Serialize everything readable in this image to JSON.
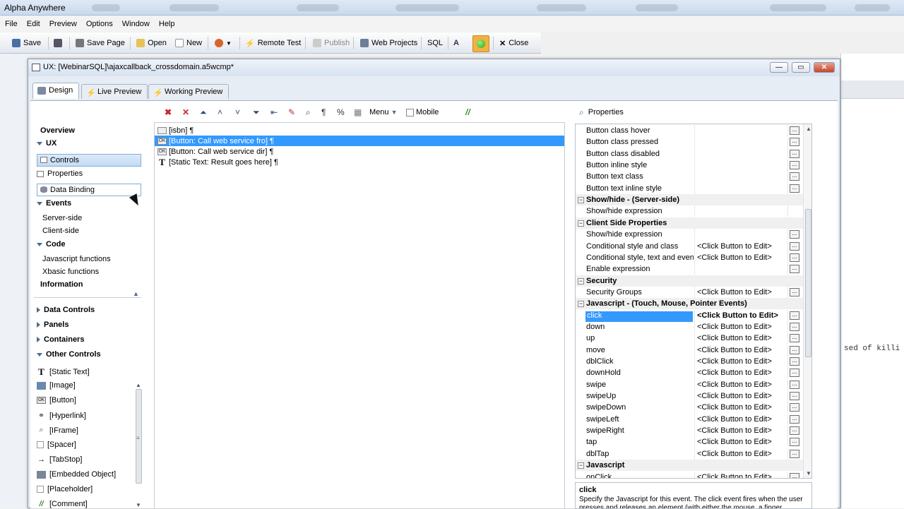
{
  "app": {
    "title": "Alpha Anywhere"
  },
  "menu": [
    "File",
    "Edit",
    "Preview",
    "Options",
    "Window",
    "Help"
  ],
  "toolbar": {
    "save": "Save",
    "save_page": "Save Page",
    "open": "Open",
    "new": "New",
    "remote_test": "Remote Test",
    "publish": "Publish",
    "web_projects": "Web Projects",
    "sql": "SQL",
    "close": "Close"
  },
  "dialog": {
    "title": "UX: [WebinarSQL]\\ajaxcallback_crossdomain.a5wcmp*"
  },
  "tabs": [
    "Design",
    "Live Preview",
    "Working Preview"
  ],
  "leftnav": {
    "overview": "Overview",
    "ux": "UX",
    "controls": "Controls",
    "properties": "Properties",
    "data_binding": "Data Binding",
    "events": "Events",
    "server_side": "Server-side",
    "client_side": "Client-side",
    "code": "Code",
    "js_functions": "Javascript functions",
    "xbasic_functions": "Xbasic functions",
    "information": "Information",
    "data_controls": "Data Controls",
    "panels": "Panels",
    "containers": "Containers",
    "other_controls": "Other Controls",
    "controls_list": [
      "[Static Text]",
      "[Image]",
      "[Button]",
      "[Hyperlink]",
      "[IFrame]",
      "[Spacer]",
      "[TabStop]",
      "[Embedded Object]",
      "[Placeholder]",
      "[Comment]"
    ]
  },
  "editor": {
    "menu_label": "Menu",
    "mobile_label": "Mobile"
  },
  "tree": [
    "[isbn] ¶",
    "[Button: Call web service fro] ¶",
    "[Button: Call web service dir] ¶",
    "[Static Text: Result goes here] ¶"
  ],
  "props": {
    "header": "Properties",
    "rows": [
      {
        "t": "p",
        "n": "Button class hover",
        "v": "",
        "e": true
      },
      {
        "t": "p",
        "n": "Button class pressed",
        "v": "",
        "e": true
      },
      {
        "t": "p",
        "n": "Button class disabled",
        "v": "",
        "e": true
      },
      {
        "t": "p",
        "n": "Button inline style",
        "v": "",
        "e": true
      },
      {
        "t": "p",
        "n": "Button text class",
        "v": "",
        "e": true
      },
      {
        "t": "p",
        "n": "Button text inline style",
        "v": "",
        "e": true
      },
      {
        "t": "s",
        "n": "Show/hide - (Server-side)"
      },
      {
        "t": "p",
        "n": "Show/hide expression",
        "v": "",
        "e": false
      },
      {
        "t": "s",
        "n": "Client Side Properties"
      },
      {
        "t": "p",
        "n": "Show/hide expression",
        "v": "",
        "e": true
      },
      {
        "t": "p",
        "n": "Conditional style and class",
        "v": "<Click Button to Edit>",
        "e": true
      },
      {
        "t": "p",
        "n": "Conditional style, text and events",
        "v": "<Click Button to Edit>",
        "e": true
      },
      {
        "t": "p",
        "n": "Enable expression",
        "v": "",
        "e": true
      },
      {
        "t": "s",
        "n": "Security"
      },
      {
        "t": "p",
        "n": "Security Groups",
        "v": "<Click Button to Edit>",
        "e": true
      },
      {
        "t": "s",
        "n": "Javascript - (Touch, Mouse, Pointer Events)"
      },
      {
        "t": "p",
        "n": "click",
        "v": "<Click Button to Edit>",
        "e": true,
        "sel": true
      },
      {
        "t": "p",
        "n": "down",
        "v": "<Click Button to Edit>",
        "e": true
      },
      {
        "t": "p",
        "n": "up",
        "v": "<Click Button to Edit>",
        "e": true
      },
      {
        "t": "p",
        "n": "move",
        "v": "<Click Button to Edit>",
        "e": true
      },
      {
        "t": "p",
        "n": "dblClick",
        "v": "<Click Button to Edit>",
        "e": true
      },
      {
        "t": "p",
        "n": "downHold",
        "v": "<Click Button to Edit>",
        "e": true
      },
      {
        "t": "p",
        "n": "swipe",
        "v": "<Click Button to Edit>",
        "e": true
      },
      {
        "t": "p",
        "n": "swipeUp",
        "v": "<Click Button to Edit>",
        "e": true
      },
      {
        "t": "p",
        "n": "swipeDown",
        "v": "<Click Button to Edit>",
        "e": true
      },
      {
        "t": "p",
        "n": "swipeLeft",
        "v": "<Click Button to Edit>",
        "e": true
      },
      {
        "t": "p",
        "n": "swipeRight",
        "v": "<Click Button to Edit>",
        "e": true
      },
      {
        "t": "p",
        "n": "tap",
        "v": "<Click Button to Edit>",
        "e": true
      },
      {
        "t": "p",
        "n": "dblTap",
        "v": "<Click Button to Edit>",
        "e": true
      },
      {
        "t": "s",
        "n": "Javascript"
      },
      {
        "t": "p",
        "n": "onClick",
        "v": "<Click Button to Edit>",
        "e": true
      }
    ]
  },
  "description": {
    "title": "click",
    "text": "Specify the Javascript for this event. The click event fires when the user presses and releases an element (with either the mouse, a finger"
  },
  "background": {
    "mono_text": "sed of killi"
  }
}
